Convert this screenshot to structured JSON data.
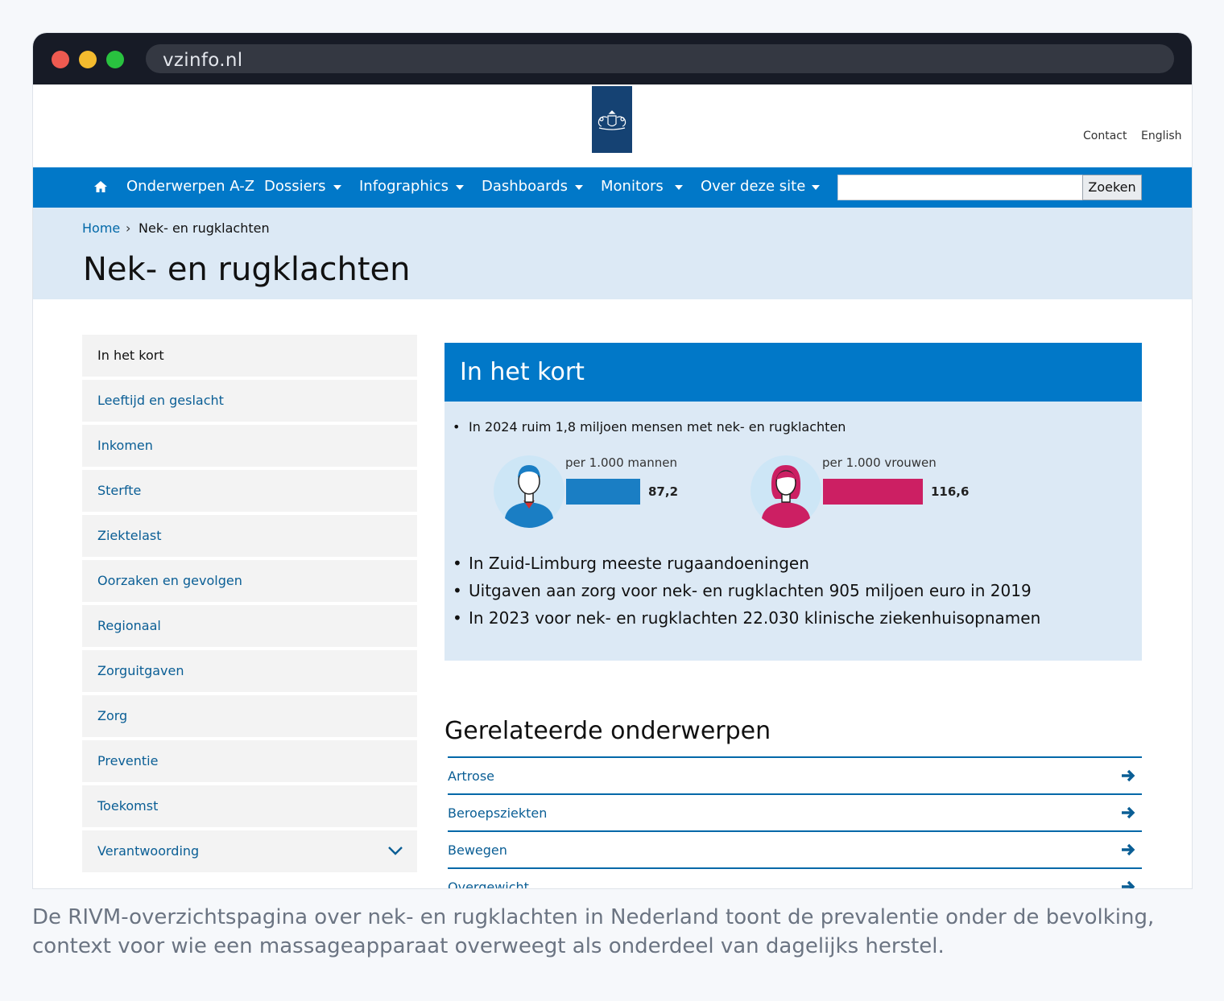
{
  "browser": {
    "url": "vzinfo.nl"
  },
  "header": {
    "links": [
      "Contact",
      "English"
    ]
  },
  "nav": {
    "items": [
      "Onderwerpen A-Z",
      "Dossiers",
      "Infographics",
      "Dashboards",
      "Monitors",
      "Over deze site"
    ],
    "search_button": "Zoeken",
    "search_value": ""
  },
  "breadcrumb": {
    "home": "Home",
    "separator": "›",
    "current": "Nek- en rugklachten"
  },
  "page_title": "Nek- en rugklachten",
  "sidebar": {
    "items": [
      "In het kort",
      "Leeftijd en geslacht",
      "Inkomen",
      "Sterfte",
      "Ziektelast",
      "Oorzaken en gevolgen",
      "Regionaal",
      "Zorguitgaven",
      "Zorg",
      "Preventie",
      "Toekomst",
      "Verantwoording"
    ]
  },
  "kort": {
    "title": "In het kort",
    "bullet_first": "In 2024 ruim 1,8 miljoen mensen met nek- en rugklachten",
    "infographic": {
      "men_label": "per 1.000 mannen",
      "men_value": "87,2",
      "women_label": "per 1.000 vrouwen",
      "women_value": "116,6",
      "men_color": "#1a7ec4",
      "women_color": "#cc1f63"
    },
    "bullets": [
      "In Zuid-Limburg meeste rugaandoeningen",
      "Uitgaven aan zorg voor nek- en rugklachten 905 miljoen euro in 2019",
      "In 2023 voor nek- en rugklachten 22.030 klinische ziekenhuisopnamen"
    ]
  },
  "related": {
    "title": "Gerelateerde onderwerpen",
    "items": [
      "Artrose",
      "Beroepsziekten",
      "Bewegen",
      "Overgewicht"
    ]
  },
  "caption": "De RIVM-overzichtspagina over nek- en rugklachten in Nederland toont de prevalentie onder de bevolking, context voor wie een massageapparaat overweegt als onderdeel van dagelijks herstel.",
  "colors": {
    "primary": "#0178c8",
    "hero": "#dce9f5",
    "link": "#0a5e95",
    "logo": "#154273"
  }
}
